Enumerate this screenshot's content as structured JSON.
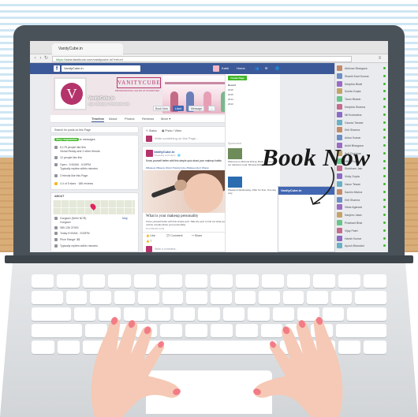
{
  "browser": {
    "tab_title": "VanityCube.in",
    "url_https": "https://",
    "url_rest": "www.facebook.com/vanitycube.in/?ref=nf"
  },
  "facebook": {
    "search_value": "VanityCube.in",
    "nav": [
      "Kabir",
      "Home"
    ],
    "page": {
      "brand": "VANITYCUBE",
      "brand_sub": "PROFESSIONAL SALON AT DOORSTEP",
      "name": "VanityCube.in",
      "category": "Spa, Beauty & Personal Care",
      "buttons": [
        "Book Now",
        "Liked",
        "Message",
        "..."
      ],
      "tabs": [
        "Timeline",
        "About",
        "Photos",
        "Reviews",
        "More ▾"
      ],
      "active_tab": "Timeline"
    },
    "left": {
      "search_placeholder": "Search for posts on this Page",
      "rows": [
        {
          "badge": "Very responsive",
          "text": "to messages"
        },
        {
          "text": "6,178 people like this",
          "sub": "Vishal Reddy and 2 other friends"
        },
        {
          "text": "12 people like this"
        },
        {
          "text": "Open - 9:00AM - 9:00PM",
          "sub": "Typically replies within minutes"
        },
        {
          "text": "3 friends like this Page"
        },
        {
          "text": "4.4 of 5 stars · 186 reviews"
        }
      ],
      "about_label": "ABOUT",
      "address": "Gurgaon (Delhi NCR)",
      "address_sub": "Gurgaon",
      "phone": "080-136 37000",
      "hours": "Today 9:00AM - 9:00PM",
      "price": "Price Range: $$",
      "reply": "Typically replies within minutes",
      "map_label": "Map"
    },
    "composer": {
      "tabs": [
        "Status",
        "Photo / Video"
      ],
      "placeholder": "Write something on this Page..."
    },
    "post": {
      "author": "VanityCube.in",
      "time": "Yesterday at 6:14pm · ",
      "text": "Know yourself better with this simple quiz about your makeup habits",
      "tags": "#Makeup #Beauty #Quiz #VanityCube #MakeupQuiz #Salon",
      "link_title": "What is your makeup personality",
      "link_desc": "Know yourself better with this simple quiz. Take the quiz to find out what your makeup routine reveals about your personality.",
      "domain": "PLAYBUZZ.COM",
      "actions": [
        "Like",
        "Comment",
        "Share"
      ],
      "likes": "7",
      "comment_placeholder": "Write a comment..."
    },
    "ticker": {
      "create_page": "Create Page",
      "years": [
        "Recent",
        "2016",
        "2015",
        "2014",
        "2013"
      ],
      "sponsored": "Sponsored",
      "ad1": "Welcome to Mimosa Dining. Book now to enjoy our delicious meal. Mimosa Dining",
      "ad2": "Weekend Wednesday. Offer for 31st. One day only."
    },
    "chat": {
      "title": "VanityCube.in"
    },
    "friends": [
      "Abhinav Bhargava",
      "Shashi Kant Kourav",
      "Deepika Bhatt",
      "Sunita Gupta",
      "Tarun Bhasin",
      "Deepika Sharma",
      "Nil Kushwaha",
      "Gaurav Tanwar",
      "Kirti Sharma",
      "Ankur Kumar",
      "Ankit Bhargava",
      "Anil Chauhan",
      "Vikas Kumar",
      "Shubham Jain",
      "Vicky Gupta",
      "Varun Tewari",
      "Sachin Mishra",
      "Kriti Sharma",
      "Vikas Agarwal",
      "Sanjeev Jatav",
      "Prashant Bhat",
      "Vijay Patel",
      "Harish Kumar",
      "Ayush Bhandari"
    ]
  },
  "overlay": {
    "book_now": "Book Now"
  },
  "colors": {
    "facebook_blue": "#3b5998",
    "brand_pink": "#b5336b",
    "laptop_body": "#4a5259",
    "nail_color": "#f27c86",
    "desk": "#d9ad78"
  }
}
